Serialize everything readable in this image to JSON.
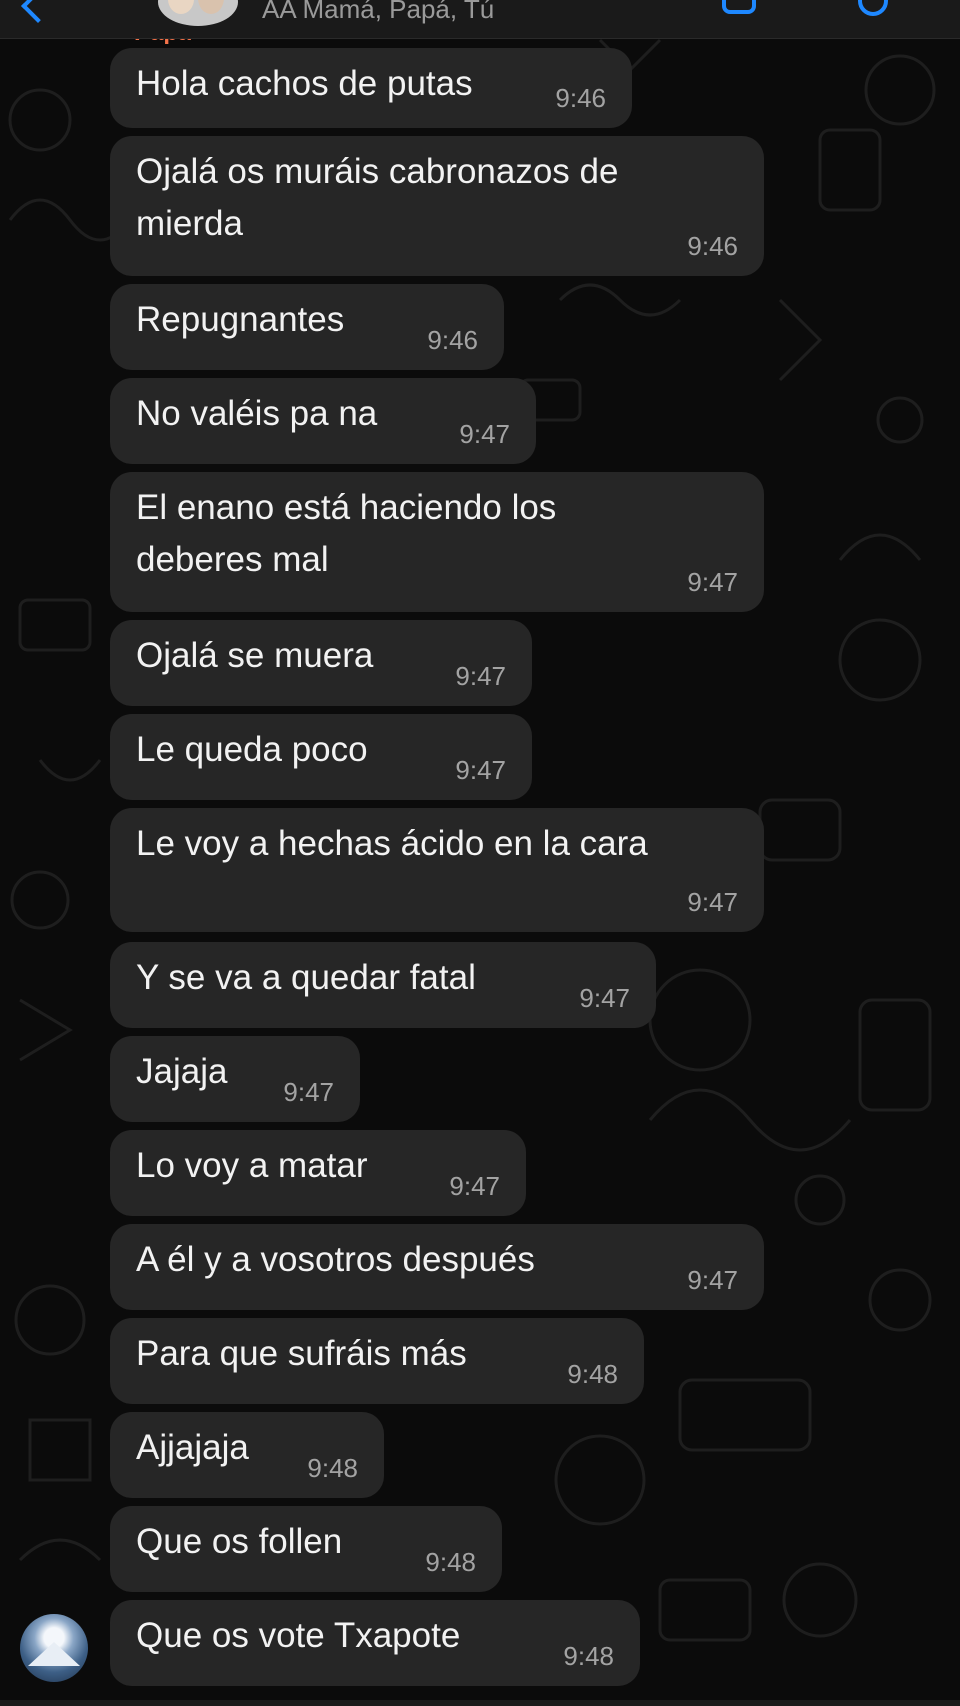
{
  "header": {
    "members": "AA Mamá, Papá, Tú"
  },
  "sender": "Papá",
  "messages": [
    {
      "text": "Hola cachos de putas",
      "time": "9:46"
    },
    {
      "text": "Ojalá os muráis cabronazos de\nmierda",
      "time": "9:46"
    },
    {
      "text": "Repugnantes",
      "time": "9:46"
    },
    {
      "text": "No valéis pa na",
      "time": "9:47"
    },
    {
      "text": "El enano está haciendo los\ndeberes mal",
      "time": "9:47"
    },
    {
      "text": "Ojalá se muera",
      "time": "9:47"
    },
    {
      "text": "Le queda poco",
      "time": "9:47"
    },
    {
      "text": "Le voy a hechas ácido en la cara",
      "time": "9:47"
    },
    {
      "text": "Y se va a quedar fatal",
      "time": "9:47"
    },
    {
      "text": "Jajaja",
      "time": "9:47"
    },
    {
      "text": "Lo voy a matar",
      "time": "9:47"
    },
    {
      "text": "A él y a vosotros después",
      "time": "9:47"
    },
    {
      "text": "Para que sufráis más",
      "time": "9:48"
    },
    {
      "text": "Ajjajaja",
      "time": "9:48"
    },
    {
      "text": "Que os follen",
      "time": "9:48"
    },
    {
      "text": "Que os vote Txapote",
      "time": "9:48"
    }
  ],
  "colors": {
    "background": "#0b0b0b",
    "bubble": "#262626",
    "accent": "#1e88ff",
    "sender_name": "#f4734a",
    "timestamp": "#a3a3a3"
  },
  "icons": [
    "back-chevron-icon",
    "video-call-icon",
    "voice-call-icon"
  ]
}
